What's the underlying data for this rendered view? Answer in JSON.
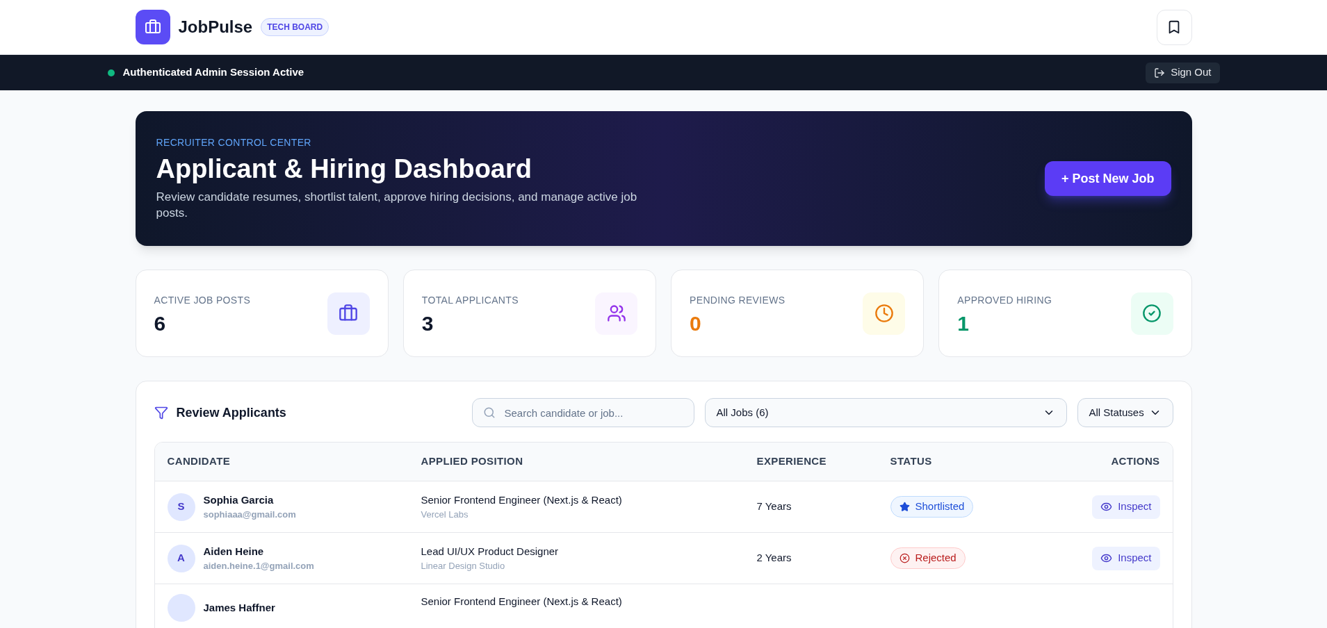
{
  "header": {
    "brand": "JobPulse",
    "badge": "TECH BOARD"
  },
  "session_bar": {
    "status": "Authenticated Admin Session Active",
    "sign_out": "Sign Out"
  },
  "hero": {
    "eyebrow": "RECRUITER CONTROL CENTER",
    "title": "Applicant & Hiring Dashboard",
    "description": "Review candidate resumes, shortlist talent, approve hiring decisions, and manage active job posts.",
    "button": "+ Post New Job"
  },
  "stats": [
    {
      "kind": "jobs",
      "label": "ACTIVE JOB POSTS",
      "value": "6"
    },
    {
      "kind": "applicants",
      "label": "TOTAL APPLICANTS",
      "value": "3"
    },
    {
      "kind": "pending",
      "label": "PENDING REVIEWS",
      "value": "0"
    },
    {
      "kind": "approved",
      "label": "APPROVED HIRING",
      "value": "1"
    }
  ],
  "review": {
    "title": "Review Applicants",
    "search": {
      "placeholder": "Search candidate or job..."
    },
    "job_filter": "All Jobs (6)",
    "status_filter": "All Statuses",
    "columns": [
      "CANDIDATE",
      "APPLIED POSITION",
      "EXPERIENCE",
      "STATUS",
      "ACTIONS"
    ],
    "rows": [
      {
        "initial": "S",
        "name": "Sophia Garcia",
        "email": "sophiaaa@gmail.com",
        "position": "Senior Frontend Engineer (Next.js & React)",
        "company": "Vercel Labs",
        "experience": "7 Years",
        "status": {
          "kind": "shortlisted",
          "label": "Shortlisted"
        },
        "action": "Inspect"
      },
      {
        "initial": "A",
        "name": "Aiden Heine",
        "email": "aiden.heine.1@gmail.com",
        "position": "Lead UI/UX Product Designer",
        "company": "Linear Design Studio",
        "experience": "2 Years",
        "status": {
          "kind": "rejected",
          "label": "Rejected"
        },
        "action": "Inspect"
      },
      {
        "name": "James Haffner",
        "position": "Senior Frontend Engineer (Next.js & React)"
      }
    ]
  }
}
